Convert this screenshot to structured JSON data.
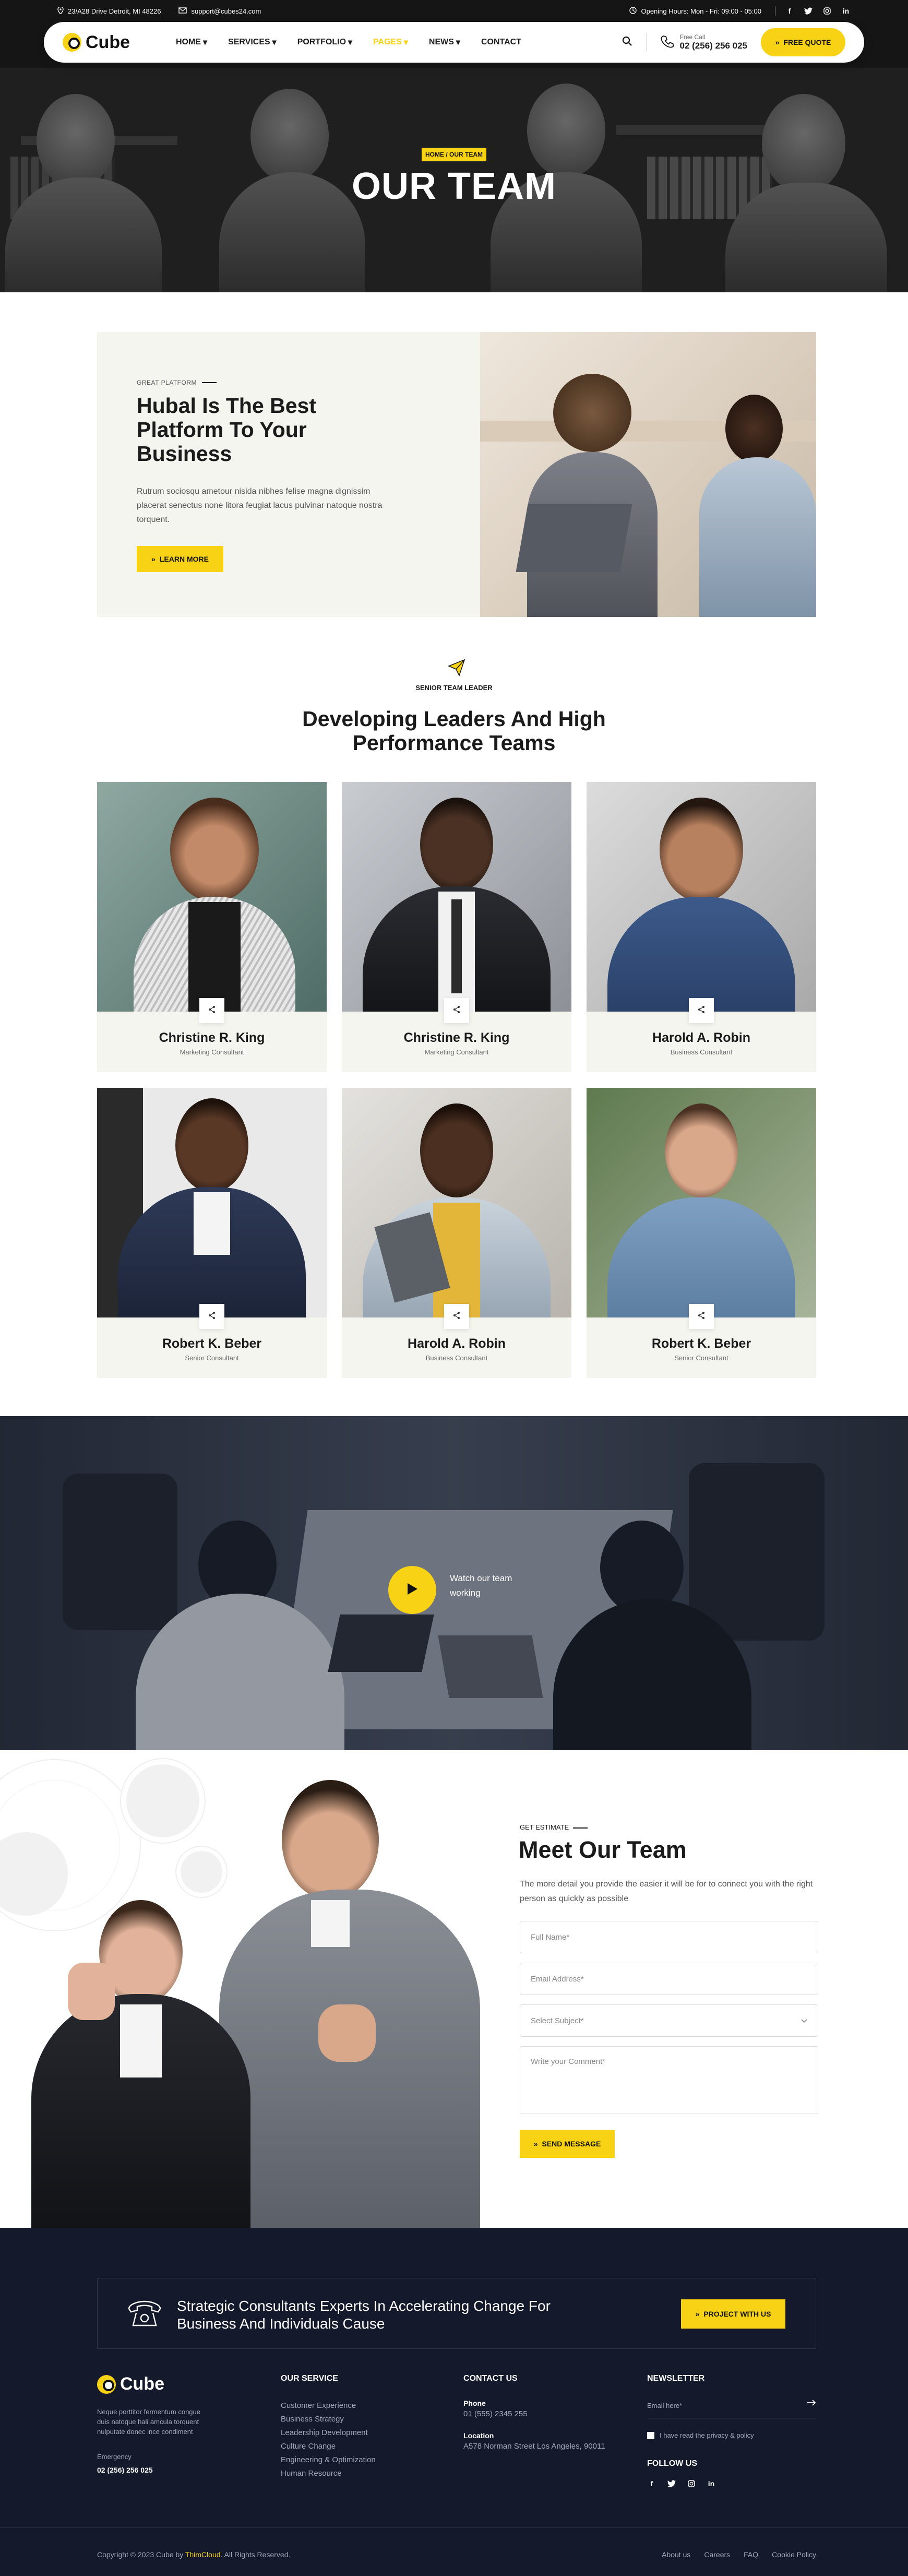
{
  "topbar": {
    "address": "23/A28 Drive Detroit, MI 48226",
    "email": "support@cubes24.com",
    "hours": "Opening Hours: Mon - Fri: 09:00 - 05:00",
    "social": [
      "f",
      "t",
      "ig",
      "in"
    ]
  },
  "nav": {
    "logo": "Cube",
    "menu": [
      {
        "label": "HOME",
        "caret": "▾"
      },
      {
        "label": "SERVICES",
        "caret": "▾"
      },
      {
        "label": "PORTFOLIO",
        "caret": "▾"
      },
      {
        "label": "PAGES",
        "caret": "▾"
      },
      {
        "label": "NEWS",
        "caret": "▾"
      },
      {
        "label": "CONTACT",
        "caret": ""
      }
    ],
    "phone_label": "Free Call",
    "phone": "02 (256) 256 025",
    "quote_btn": "FREE QUOTE"
  },
  "hero": {
    "breadcrumb": "HOME / OUR TEAM",
    "title": "OUR TEAM"
  },
  "about": {
    "eyebrow": "GREAT PLATFORM",
    "title": "Hubal Is The Best Platform To Your Business",
    "text": "Rutrum sociosqu ametour nisida nibhes felise magna dignissim placerat senectus none litora feugiat lacus pulvinar natoque nostra torquent.",
    "button": "LEARN MORE"
  },
  "team": {
    "eyebrow": "SENIOR TEAM LEADER",
    "title": "Developing Leaders And High Performance Teams",
    "members": [
      {
        "name": "Christine R. King",
        "role": "Marketing Consultant"
      },
      {
        "name": "Christine R. King",
        "role": "Marketing Consultant"
      },
      {
        "name": "Harold A. Robin",
        "role": "Business Consultant"
      },
      {
        "name": "Robert K. Beber",
        "role": "Senior Consultant"
      },
      {
        "name": "Harold A. Robin",
        "role": "Business Consultant"
      },
      {
        "name": "Robert K. Beber",
        "role": "Senior Consultant"
      }
    ]
  },
  "video": {
    "label": "Watch our team working"
  },
  "contact": {
    "eyebrow": "GET ESTIMATE",
    "title": "Meet Our Team",
    "text": "The more detail you provide the easier it will be for to connect you with the right person as quickly as possible",
    "fields": {
      "name": "Full Name*",
      "email": "Email Address*",
      "subject": "Select Subject*",
      "comment": "Write your Comment*"
    },
    "button": "SEND MESSAGE"
  },
  "footer": {
    "cta_text": "Strategic Consultants Experts In Accelerating Change For Business And Individuals Cause",
    "cta_button": "PROJECT WITH US",
    "logo": "Cube",
    "about": "Neque porttitor fermentum congue duis natoque hali amcula torquent nulputate donec ince condiment",
    "emergency_label": "Emergency",
    "emergency_phone": "02 (256) 256 025",
    "service_head": "OUR SERVICE",
    "services": [
      "Customer Experience",
      "Business Strategy",
      "Leadership Development",
      "Culture Change",
      "Engineering & Optimization",
      "Human Resource"
    ],
    "contact_head": "CONTACT US",
    "phone_label": "Phone",
    "phone": "01 (555) 2345 255",
    "location_label": "Location",
    "location": "A578 Norman Street Los Angeles, 90011",
    "newsletter_head": "NEWSLETTER",
    "email_placeholder": "Email here*",
    "privacy": "I have read the privacy & policy",
    "follow_head": "FOLLOW US",
    "copyright_pre": "Copyright © 2023 Cube by ",
    "copyright_brand": "ThimCloud",
    "copyright_post": ". All Rights Reserved.",
    "links": [
      "About us",
      "Careers",
      "FAQ",
      "Cookie Policy"
    ]
  },
  "colors": {
    "accent": "#f7d215",
    "footer_bg": "#141a2c",
    "panel_bg": "#f5f5ef"
  }
}
